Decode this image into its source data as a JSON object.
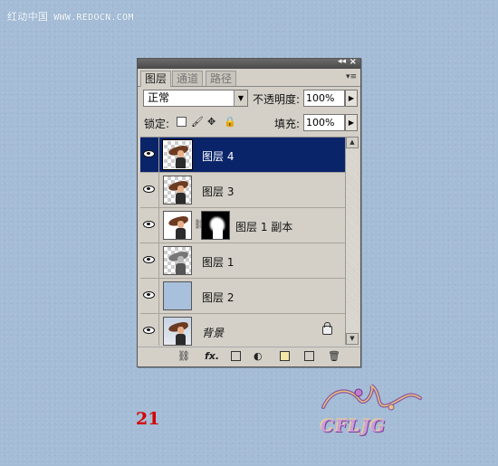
{
  "watermark": {
    "cn": "红动中国",
    "url": "WWW.REDOCN.COM"
  },
  "panel": {
    "tabs": [
      "图层",
      "通道",
      "路径"
    ],
    "blend_mode": "正常",
    "opacity_label": "不透明度:",
    "opacity_value": "100%",
    "lock_label": "锁定:",
    "fill_label": "填充:",
    "fill_value": "100%",
    "layers": [
      {
        "name": "图层 4",
        "selected": true,
        "visible": true
      },
      {
        "name": "图层 3",
        "selected": false,
        "visible": true
      },
      {
        "name": "图层 1 副本",
        "selected": false,
        "visible": true,
        "has_mask": true
      },
      {
        "name": "图层 1",
        "selected": false,
        "visible": true
      },
      {
        "name": "图层 2",
        "selected": false,
        "visible": true
      },
      {
        "name": "背景",
        "selected": false,
        "visible": true,
        "locked": true
      }
    ],
    "toolbar_icons": [
      "link-layers-icon",
      "fx-icon",
      "add-mask-icon",
      "adjustment-layer-icon",
      "new-group-icon",
      "new-layer-icon",
      "trash-icon"
    ],
    "fx_label": "fx."
  },
  "step_number": "21",
  "logo_text": "CFLJG",
  "colors": {
    "selection": "#0a246a",
    "background": "#a4bcd6",
    "step_number": "#d40000"
  }
}
